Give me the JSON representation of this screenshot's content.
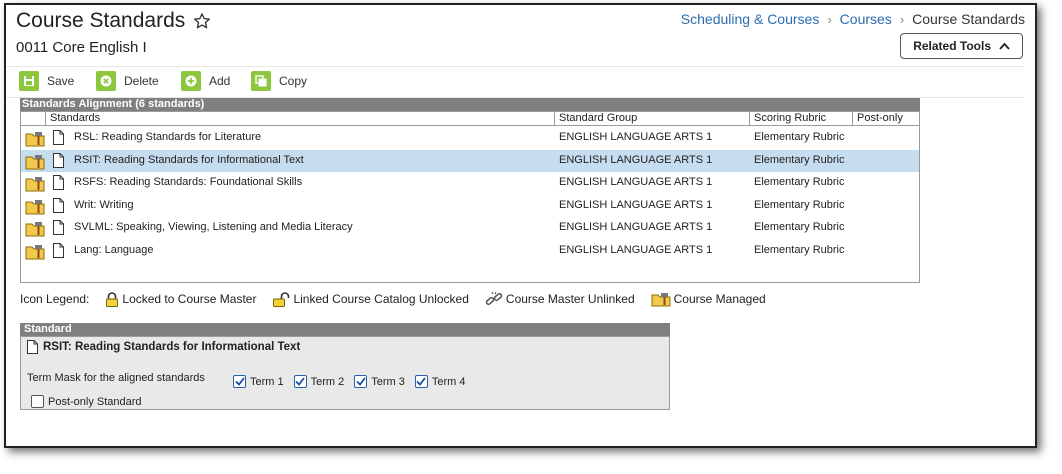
{
  "header": {
    "title": "Course Standards",
    "subtitle": "0011 Core English I",
    "breadcrumb": [
      "Scheduling & Courses",
      "Courses",
      "Course Standards"
    ],
    "related_tools": "Related Tools"
  },
  "toolbar": {
    "save": "Save",
    "delete": "Delete",
    "add": "Add",
    "copy": "Copy"
  },
  "alignment": {
    "title": "Standards Alignment (6 standards)",
    "columns": [
      "Standards",
      "Standard Group",
      "Scoring Rubric",
      "Post-only"
    ],
    "rows": [
      {
        "standard": "RSL: Reading Standards for Literature",
        "group": "ENGLISH LANGUAGE ARTS 1",
        "rubric": "Elementary Rubric",
        "post_only": ""
      },
      {
        "standard": "RSIT: Reading Standards for Informational Text",
        "group": "ENGLISH LANGUAGE ARTS 1",
        "rubric": "Elementary Rubric",
        "post_only": ""
      },
      {
        "standard": "RSFS: Reading Standards: Foundational Skills",
        "group": "ENGLISH LANGUAGE ARTS 1",
        "rubric": "Elementary Rubric",
        "post_only": ""
      },
      {
        "standard": "Writ: Writing",
        "group": "ENGLISH LANGUAGE ARTS 1",
        "rubric": "Elementary Rubric",
        "post_only": ""
      },
      {
        "standard": "SVLML: Speaking, Viewing, Listening and Media Literacy",
        "group": "ENGLISH LANGUAGE ARTS 1",
        "rubric": "Elementary Rubric",
        "post_only": ""
      },
      {
        "standard": "Lang: Language",
        "group": "ENGLISH LANGUAGE ARTS 1",
        "rubric": "Elementary Rubric",
        "post_only": ""
      }
    ],
    "selected_row": 1
  },
  "legend": {
    "label": "Icon Legend:",
    "items": [
      "Locked to Course Master",
      "Linked Course Catalog Unlocked",
      "Course Master Unlinked",
      "Course Managed"
    ]
  },
  "standard": {
    "header": "Standard",
    "name": "RSIT: Reading Standards for Informational Text",
    "term_mask_label": "Term Mask for the aligned standards",
    "terms": [
      {
        "label": "Term 1",
        "checked": true
      },
      {
        "label": "Term 2",
        "checked": true
      },
      {
        "label": "Term 3",
        "checked": true
      },
      {
        "label": "Term 4",
        "checked": true
      }
    ],
    "post_only_label": "Post-only Standard",
    "post_only_checked": false
  },
  "colors": {
    "link": "#2b6cb0",
    "toolbar_icon": "#8dc63f",
    "panel_header": "#7f7f7f",
    "selected_row": "#c6dcef"
  }
}
